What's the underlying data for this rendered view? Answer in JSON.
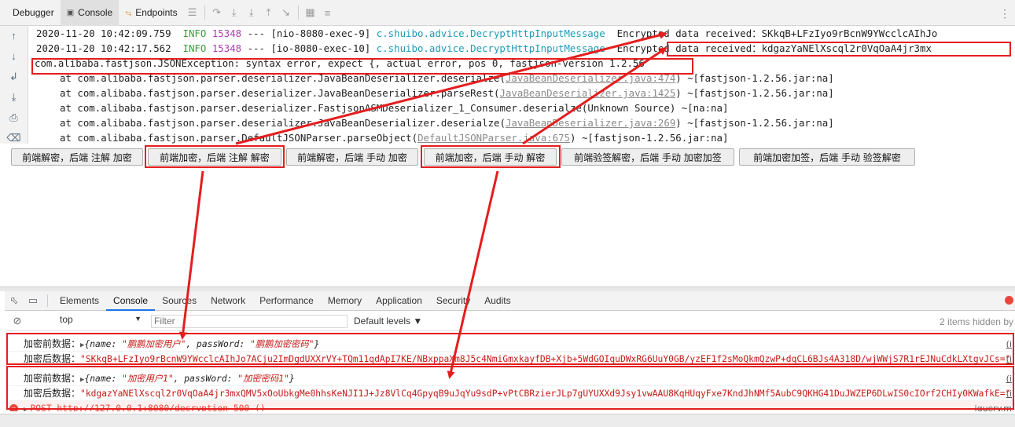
{
  "ide": {
    "tabs": [
      {
        "icon": "bug-icon",
        "label": "Debugger"
      },
      {
        "icon": "console-icon",
        "label": "Console"
      },
      {
        "icon": "endpoints-icon",
        "label": "Endpoints"
      }
    ],
    "log": {
      "line1": {
        "ts": "2020-11-20 10:42:09.759",
        "level": "INFO",
        "pid": "15348",
        "sep": "---",
        "thread": "[nio-8080-exec-9]",
        "logger": "c.shuibo.advice.DecryptHttpInputMessage",
        "msg": "Encrypted data received：SKkqB+LFzIyo9rBcnW9YWcclcAIhJo"
      },
      "line2": {
        "ts": "2020-11-20 10:42:17.562",
        "level": "INFO",
        "pid": "15348",
        "sep": "---",
        "thread": "[io-8080-exec-10]",
        "logger": "c.shuibo.advice.DecryptHttpInputMessage",
        "msg": "Encrypted data received：kdgazYaNElXscql2r0VqOaA4jr3mx"
      },
      "exception": "com.alibaba.fastjson.JSONException: syntax error, expect {, actual error, pos 0, fastjson-version 1.2.56",
      "stack": [
        {
          "text": "at com.alibaba.fastjson.parser.deserializer.JavaBeanDeserializer.deserialze(",
          "link": "JavaBeanDeserializer.java:474",
          "tail": ") ~[fastjson-1.2.56.jar:na]"
        },
        {
          "text": "at com.alibaba.fastjson.parser.deserializer.JavaBeanDeserializer.parseRest(",
          "link": "JavaBeanDeserializer.java:1425",
          "tail": ") ~[fastjson-1.2.56.jar:na]"
        },
        {
          "text": "at com.alibaba.fastjson.parser.deserializer.FastjsonASMDeserializer_1_Consumer.deserialze(Unknown Source) ~[na:na]",
          "link": "",
          "tail": ""
        },
        {
          "text": "at com.alibaba.fastjson.parser.deserializer.JavaBeanDeserializer.deserialze(",
          "link": "JavaBeanDeserializer.java:269",
          "tail": ") ~[fastjson-1.2.56.jar:na]"
        },
        {
          "text": "at com.alibaba.fastjson.parser.DefaultJSONParser.parseObject(",
          "link": "DefaultJSONParser.java:675",
          "tail": ") ~[fastjson-1.2.56.jar:na]"
        }
      ]
    }
  },
  "page_buttons": [
    "前端解密，后端 注解 加密",
    "前端加密，后端 注解 解密",
    "前端解密，后端 手动 加密",
    "前端加密，后端 手动 解密",
    "前端验签解密，后端 手动 加密加签",
    "前端加密加签，后端 手动 验签解密"
  ],
  "devtools": {
    "tabs": [
      "Elements",
      "Console",
      "Sources",
      "Network",
      "Performance",
      "Memory",
      "Application",
      "Security",
      "Audits"
    ],
    "active_tab": "Console",
    "context": "top",
    "filter_placeholder": "Filter",
    "levels": "Default levels ▼",
    "hidden": "2 items hidden by",
    "messages": [
      {
        "label": "加密前数据：",
        "arrow": "▶",
        "pre": "{name: ",
        "v1": "\"鹏鹏加密用户\"",
        "mid": ", passWord: ",
        "v2": "\"鹏鹏加密密码\"",
        "post": "}",
        "src": "(i"
      },
      {
        "label": "加密后数据：",
        "value": "\"SKkqB+LFzIyo9rBcnW9YWcclcAIhJo7ACju2ImDgdUXXrVY+TQm11qdApI7KE/NBxppaXm8J5c4NmiGmxkayfDB+Xjb+5WdGOIquDWxRG6UuY0GB/yzEF1f2sMoQkmQzwP+dqCL6BJs4A318D/wjWWjS7R1rEJNuCdkLXtgvJCs=\"",
        "src": "(i"
      },
      {
        "label": "加密前数据：",
        "arrow": "▶",
        "pre": "{name: ",
        "v1": "\"加密用户1\"",
        "mid": ", passWord: ",
        "v2": "\"加密密码1\"",
        "post": "}",
        "src": "(i"
      },
      {
        "label": "加密后数据：",
        "value": "\"kdgazYaNElXscql2r0VqOaA4jr3mxQMV5xOoUbkgMe0hhsKeNJI1J+Jz8VlCq4GpyqB9uJqYu9sdP+vPtCBRzierJLp7gUYUXXd9Jsy1vwAAU8KqHUqyFxe7KndJhNMf5AubC9QKHG41DuJWZEP6DLwIS0cIOrf2CHIy0KWafkE=\"",
        "src": "(i"
      }
    ],
    "error": {
      "text": "POST http://127.0.0.1:8080/decryption 500 ()",
      "src": "jquery.m"
    }
  }
}
